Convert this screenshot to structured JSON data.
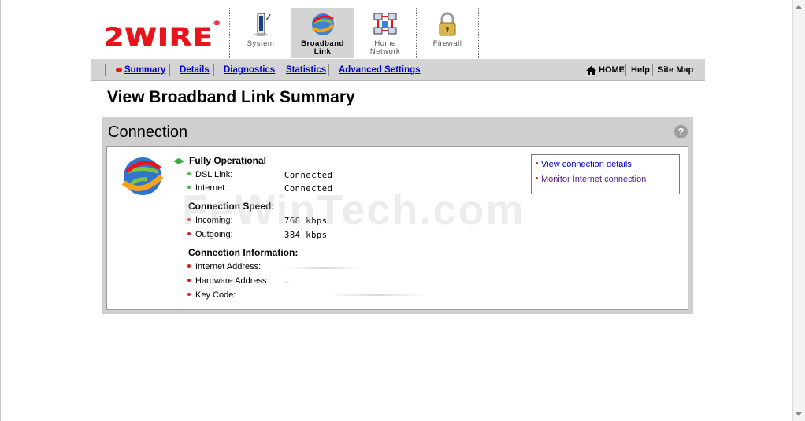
{
  "brand": {
    "logo_text": "2WIRE",
    "reg_mark": "®",
    "brand_color": "#e8141b"
  },
  "tabs": [
    {
      "label_line1": "System",
      "label_line2": "",
      "icon": "system-icon",
      "active": false
    },
    {
      "label_line1": "Broadband",
      "label_line2": "Link",
      "icon": "globe-icon",
      "active": true
    },
    {
      "label_line1": "Home",
      "label_line2": "Network",
      "icon": "network-icon",
      "active": false
    },
    {
      "label_line1": "Firewall",
      "label_line2": "",
      "icon": "lock-icon",
      "active": false
    }
  ],
  "subnav": {
    "items": [
      "Summary",
      "Details",
      "Diagnostics",
      "Statistics",
      "Advanced Settings"
    ],
    "home": "HOME",
    "help": "Help",
    "sitemap": "Site Map"
  },
  "page": {
    "title": "View Broadband Link Summary",
    "panel_title": "Connection",
    "help_glyph": "?"
  },
  "connection": {
    "status": "Fully Operational",
    "rows": [
      {
        "label": "DSL Link:",
        "value": "Connected"
      },
      {
        "label": "Internet:",
        "value": "Connected"
      }
    ],
    "speed_heading": "Connection Speed:",
    "speed_rows": [
      {
        "label": "Incoming:",
        "value": "768  kbps"
      },
      {
        "label": "Outgoing:",
        "value": "384  kbps"
      }
    ],
    "info_heading": "Connection Information:",
    "info_rows": [
      {
        "label": "Internet Address:"
      },
      {
        "label": "Hardware Address:"
      },
      {
        "label": "Key Code:"
      }
    ]
  },
  "links": {
    "details": "View connection details",
    "monitor": "Monitor Internet connection"
  },
  "watermark": "FeWinTech.com",
  "colors": {
    "nav_bg": "#d4d4d4",
    "link": "#0000cc",
    "visited": "#551a8b",
    "status_green": "#3fa93f"
  }
}
